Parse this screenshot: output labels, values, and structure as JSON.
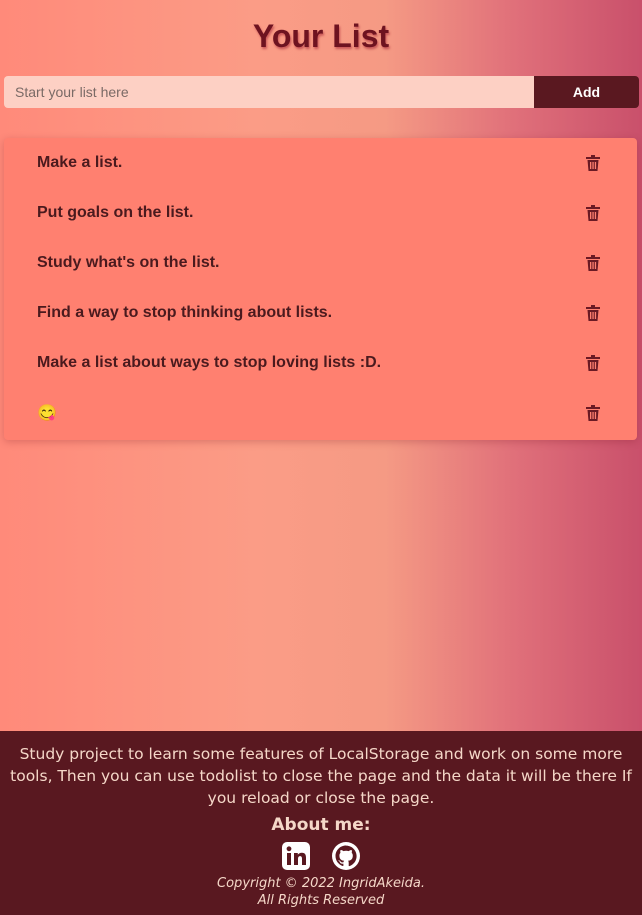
{
  "header": {
    "title": "Your List"
  },
  "form": {
    "placeholder": "Start your list here",
    "add_label": "Add"
  },
  "list": {
    "items": [
      {
        "text": "Make a list."
      },
      {
        "text": "Put goals on the list."
      },
      {
        "text": "Study what's on the list."
      },
      {
        "text": "Find a way to stop thinking about lists."
      },
      {
        "text": "Make a list about ways to stop loving lists :D."
      },
      {
        "text": "😋"
      }
    ]
  },
  "footer": {
    "description": "Study project to learn some features of LocalStorage and work on some more tools, Then you can use todolist to close the page and the data it will be there If you reload or close the page.",
    "about": "About me:",
    "copyright_line1": "Copyright © 2022 IngridAkeida.",
    "copyright_line2": "All Rights Reserved"
  },
  "colors": {
    "accent_dark": "#591820",
    "list_background": "#ff8070",
    "input_background": "#fdd0c4"
  },
  "icons": [
    "trash-icon",
    "linkedin-icon",
    "github-icon"
  ]
}
